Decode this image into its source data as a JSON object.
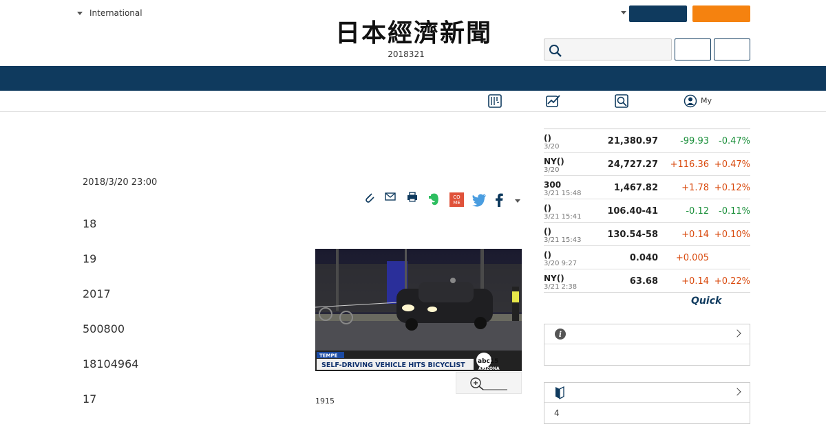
{
  "header": {
    "edition_label": "International",
    "logo_text": "日本經濟新聞",
    "date_text": "2018321"
  },
  "subnav": {
    "my_label": "My"
  },
  "article": {
    "timestamp": "2018/3/20 23:00",
    "paragraphs": [
      "18",
      "19",
      "2017",
      "500800",
      "18104964",
      "17"
    ],
    "photo_caption": "1915",
    "photo_overlay": {
      "location": "TEMPE",
      "headline": "SELF-DRIVING VEHICLE HITS BICYCLIST",
      "channel": "abc15",
      "region": "ARIZONA"
    }
  },
  "markets": [
    {
      "name": "()",
      "date": "3/20",
      "value": "21,380.97",
      "change": "-99.93",
      "percent": "-0.47%",
      "dir": "neg"
    },
    {
      "name": "NY()",
      "date": "3/20",
      "value": "24,727.27",
      "change": "+116.36",
      "percent": "+0.47%",
      "dir": "pos"
    },
    {
      "name": "300",
      "date": "3/21 15:48",
      "value": "1,467.82",
      "change": "+1.78",
      "percent": "+0.12%",
      "dir": "pos"
    },
    {
      "name": "()",
      "date": "3/21 15:41",
      "value": "106.40-41",
      "change": "-0.12",
      "percent": "-0.11%",
      "dir": "neg"
    },
    {
      "name": "()",
      "date": "3/21 15:43",
      "value": "130.54-58",
      "change": "+0.14",
      "percent": "+0.10%",
      "dir": "pos"
    },
    {
      "name": "()",
      "date": "3/20 9:27",
      "value": "0.040",
      "change": "+0.005",
      "percent": "",
      "dir": "pos"
    },
    {
      "name": "NY()",
      "date": "3/21 2:38",
      "value": "63.68",
      "change": "+0.14",
      "percent": "+0.22%",
      "dir": "pos"
    }
  ],
  "quick_label": "Quick",
  "panels": {
    "second_body": "4"
  },
  "colors": {
    "navy": "#0f3a5e",
    "orange": "#f5820f",
    "positive": "#d94a0e",
    "negative": "#1a8f3a"
  }
}
